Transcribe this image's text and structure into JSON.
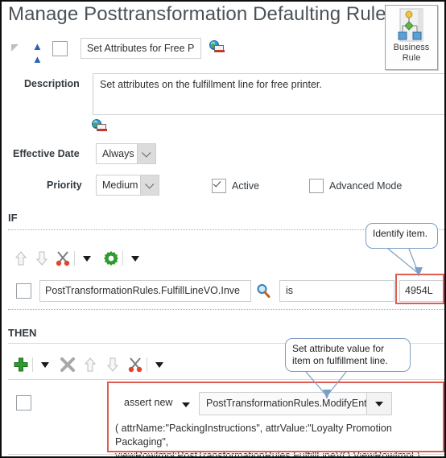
{
  "page": {
    "title": "Manage Posttransformation Defaulting Rules"
  },
  "business_rule_button": {
    "label_line1": "Business",
    "label_line2": "Rule",
    "icon": "business-rule-tree-icon"
  },
  "rule_header": {
    "collapse_icon": "triangle-collapse-icon",
    "move_up_icon": "double-chevron-up-icon",
    "select_checkbox_checked": false,
    "name_value": "Set Attributes for Free P",
    "translate_icon": "globe-screen-icon"
  },
  "description": {
    "label": "Description",
    "value": "Set attributes on the fulfillment line for free printer.",
    "translate_icon": "globe-screen-icon"
  },
  "effective_date": {
    "label": "Effective Date",
    "value": "Always"
  },
  "priority": {
    "label": "Priority",
    "value": "Medium"
  },
  "active": {
    "label": "Active",
    "checked": true
  },
  "advanced_mode": {
    "label": "Advanced Mode",
    "checked": false
  },
  "if_section": {
    "heading": "IF",
    "toolbar": [
      {
        "name": "move-up-icon",
        "glyph": "arrow-up"
      },
      {
        "name": "move-down-icon",
        "glyph": "arrow-down"
      },
      {
        "name": "cut-icon",
        "glyph": "scissors"
      },
      {
        "name": "cut-menu-icon",
        "glyph": "caret-down"
      },
      {
        "name": "settings-icon",
        "glyph": "gear"
      },
      {
        "name": "settings-menu-icon",
        "glyph": "caret-down"
      }
    ],
    "row": {
      "checkbox_checked": false,
      "lhs": "PostTransformationRules.FulfillLineVO.Inve",
      "search_icon": "magnifier-icon",
      "operator": "is",
      "value": "4954L"
    }
  },
  "then_section": {
    "heading": "THEN",
    "toolbar": [
      {
        "name": "add-icon",
        "glyph": "plus"
      },
      {
        "name": "add-menu-icon",
        "glyph": "caret-down"
      },
      {
        "name": "delete-icon",
        "glyph": "x-mark"
      },
      {
        "name": "move-up-icon",
        "glyph": "arrow-up"
      },
      {
        "name": "move-down-icon",
        "glyph": "arrow-down"
      },
      {
        "name": "cut-icon",
        "glyph": "scissors"
      },
      {
        "name": "cut-menu-icon",
        "glyph": "caret-down"
      }
    ],
    "row": {
      "checkbox_checked": false,
      "action_type": "assert new",
      "entity": "PostTransformationRules.ModifyEntity",
      "expression_line1": "( attrName:\"PackingInstructions\", attrValue:\"Loyalty Promotion Packaging\",",
      "expression_line2": "viewRowImpl:PostTransformationRules.FulfillLineVO.ViewRowImpl )"
    }
  },
  "callouts": {
    "identify_item": "Identify item.",
    "set_attribute_line1": "Set attribute value  for",
    "set_attribute_line2": "item on fulfillment  line."
  },
  "colors": {
    "highlight_red": "#e05b52",
    "callout_border": "#7c9ec4",
    "title_text": "#4a5258",
    "accent_green": "#2e9b2e"
  }
}
